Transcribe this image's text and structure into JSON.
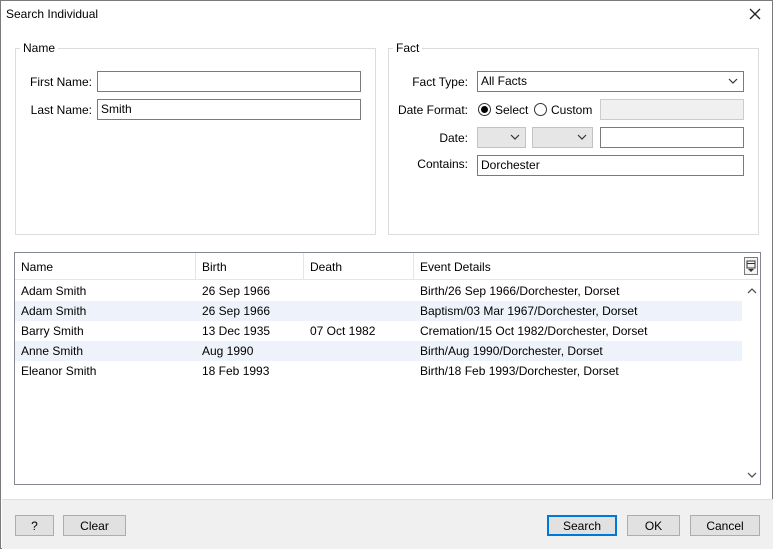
{
  "window": {
    "title": "Search Individual"
  },
  "name_group": {
    "legend": "Name",
    "first_name_label": "First Name:",
    "first_name_value": "",
    "last_name_label": "Last Name:",
    "last_name_value": "Smith"
  },
  "fact_group": {
    "legend": "Fact",
    "fact_type_label": "Fact Type:",
    "fact_type_value": "All Facts",
    "date_format_label": "Date Format:",
    "date_format_options": [
      "Select",
      "Custom"
    ],
    "date_format_selected": "Select",
    "custom_value": "",
    "date_label": "Date:",
    "date_value": "",
    "contains_label": "Contains:",
    "contains_value": "Dorchester"
  },
  "results": {
    "columns": [
      "Name",
      "Birth",
      "Death",
      "Event Details"
    ],
    "rows": [
      {
        "name": "Adam Smith",
        "birth": "26 Sep 1966",
        "death": "",
        "event": "Birth/26 Sep 1966/Dorchester, Dorset"
      },
      {
        "name": "Adam Smith",
        "birth": "26 Sep 1966",
        "death": "",
        "event": "Baptism/03 Mar 1967/Dorchester, Dorset"
      },
      {
        "name": "Barry Smith",
        "birth": "13 Dec 1935",
        "death": "07 Oct 1982",
        "event": "Cremation/15 Oct 1982/Dorchester, Dorset"
      },
      {
        "name": "Anne Smith",
        "birth": "Aug 1990",
        "death": "",
        "event": "Birth/Aug 1990/Dorchester, Dorset"
      },
      {
        "name": "Eleanor Smith",
        "birth": "18 Feb 1993",
        "death": "",
        "event": "Birth/18 Feb 1993/Dorchester, Dorset"
      }
    ]
  },
  "buttons": {
    "help": "?",
    "clear": "Clear",
    "search": "Search",
    "ok": "OK",
    "cancel": "Cancel"
  },
  "icons": {
    "close": "close-icon",
    "chevron": "chevron-down-icon",
    "column_chooser": "column-chooser-icon",
    "scroll_up": "scroll-up-icon",
    "scroll_down": "scroll-down-icon"
  },
  "colors": {
    "row_alt": "#eef3fb",
    "default_button_border": "#0078d7"
  }
}
